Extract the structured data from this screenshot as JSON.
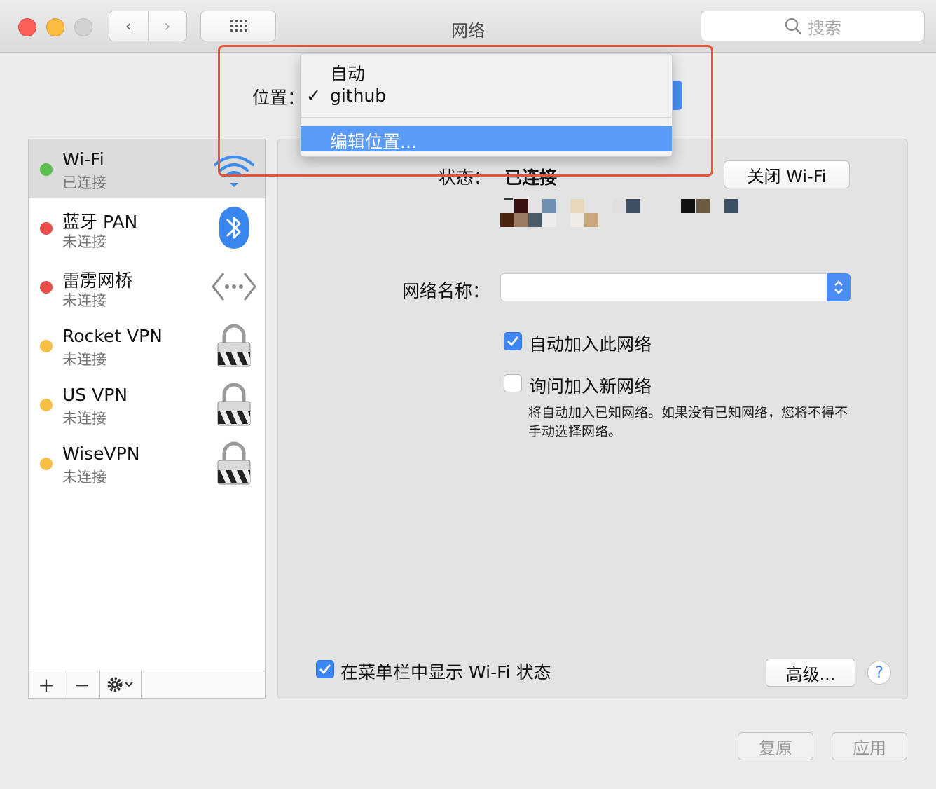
{
  "window": {
    "title": "网络"
  },
  "toolbar": {
    "search_placeholder": "搜索",
    "back_glyph": "‹",
    "forward_glyph": "›"
  },
  "location": {
    "label": "位置：",
    "menu": {
      "items": [
        {
          "label": "自动",
          "checked": false
        },
        {
          "label": "github",
          "checked": true
        }
      ],
      "check_glyph": "✓",
      "edit_label": "编辑位置..."
    }
  },
  "services": [
    {
      "name": "Wi-Fi",
      "status": "已连接",
      "status_color": "#5cbf4f",
      "icon": "wifi-icon"
    },
    {
      "name": "蓝牙 PAN",
      "status": "未连接",
      "status_color": "#e94e4b",
      "icon": "bluetooth-icon"
    },
    {
      "name": "雷雳网桥",
      "status": "未连接",
      "status_color": "#e94e4b",
      "icon": "thunderbolt-bridge-icon"
    },
    {
      "name": "Rocket VPN",
      "status": "未连接",
      "status_color": "#f6bf47",
      "icon": "lock-icon"
    },
    {
      "name": "US VPN",
      "status": "未连接",
      "status_color": "#f6bf47",
      "icon": "lock-icon"
    },
    {
      "name": "WiseVPN",
      "status": "未连接",
      "status_color": "#f6bf47",
      "icon": "lock-icon"
    }
  ],
  "sidebar_tools": {
    "add": "+",
    "remove": "−"
  },
  "wifi_panel": {
    "status_label": "状态：",
    "status_value": "已连接",
    "turn_off_button": "关闭 Wi-Fi",
    "network_name_label": "网络名称：",
    "auto_join_label": "自动加入此网络",
    "auto_join_checked": true,
    "ask_join_label": "询问加入新网络",
    "ask_join_checked": false,
    "ask_join_description": "将自动加入已知网络。如果没有已知网络，您将不得不手动选择网络。",
    "show_menubar_label": "在菜单栏中显示 Wi-Fi 状态",
    "show_menubar_checked": true,
    "advanced_button": "高级...",
    "help_glyph": "?"
  },
  "footer": {
    "revert_button": "复原",
    "apply_button": "应用"
  },
  "colors": {
    "accent": "#3d87f5",
    "menu_highlight": "#5a9bf8",
    "annotation_box": "#e8543a"
  }
}
